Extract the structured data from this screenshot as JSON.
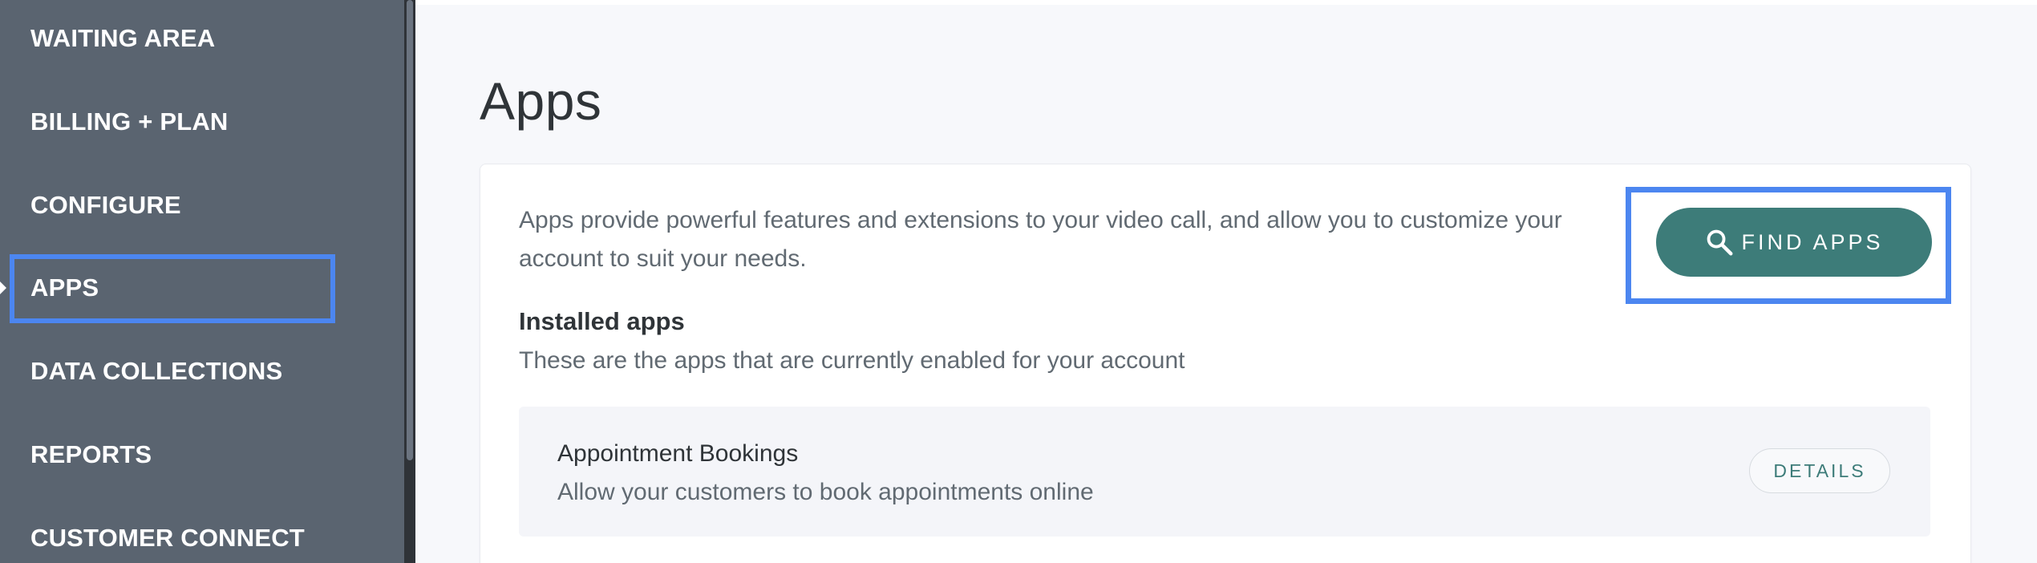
{
  "sidebar": {
    "items": [
      {
        "label": "WAITING AREA"
      },
      {
        "label": "BILLING + PLAN"
      },
      {
        "label": "CONFIGURE"
      },
      {
        "label": "APPS",
        "active": true
      },
      {
        "label": "DATA COLLECTIONS"
      },
      {
        "label": "REPORTS"
      },
      {
        "label": "CUSTOMER CONNECT"
      }
    ]
  },
  "main": {
    "title": "Apps",
    "description": "Apps provide powerful features and extensions to your video call, and allow you to customize your account to suit your needs.",
    "find_apps_label": "FIND APPS",
    "installed_title": "Installed apps",
    "installed_subtitle": "These are the apps that are currently enabled for your account",
    "apps": [
      {
        "name": "Appointment Bookings",
        "description": "Allow your customers to book appointments online",
        "details_label": "DETAILS"
      }
    ]
  },
  "colors": {
    "sidebar_bg": "#5a6470",
    "accent_teal": "#3d7c79",
    "highlight_blue": "#4c86f0"
  },
  "icons": {
    "find_apps": "search-icon",
    "active_marker": "caret-right-icon"
  }
}
